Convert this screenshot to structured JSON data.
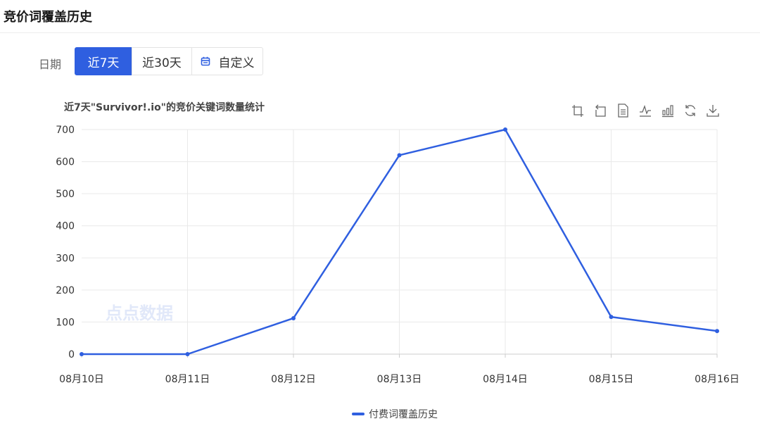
{
  "header": {
    "title": "竞价词覆盖历史"
  },
  "date_filter": {
    "label": "日期",
    "options": [
      {
        "label": "近7天",
        "active": true
      },
      {
        "label": "近30天",
        "active": false
      },
      {
        "label": "自定义",
        "active": false,
        "icon": "calendar-icon"
      }
    ]
  },
  "toolbox": [
    "zoom-icon",
    "zoom-reset-icon",
    "data-view-icon",
    "line-chart-icon",
    "bar-chart-icon",
    "restore-icon",
    "download-icon"
  ],
  "watermark": "点点数据",
  "colors": {
    "accent": "#2f5fe0",
    "grid": "#e9e9e9",
    "axis": "#cccccc",
    "tick_text": "#333333"
  },
  "chart_data": {
    "type": "line",
    "title": "近7天\"Survivor!.io\"的竞价关键词数量统计",
    "categories": [
      "08月10日",
      "08月11日",
      "08月12日",
      "08月13日",
      "08月14日",
      "08月15日",
      "08月16日"
    ],
    "series": [
      {
        "name": "付费词覆盖历史",
        "values": [
          0,
          0,
          112,
          620,
          700,
          116,
          72
        ]
      }
    ],
    "ylim": [
      0,
      700
    ],
    "yticks": [
      0,
      100,
      200,
      300,
      400,
      500,
      600,
      700
    ],
    "grid": true,
    "legend": "bottom-center"
  }
}
